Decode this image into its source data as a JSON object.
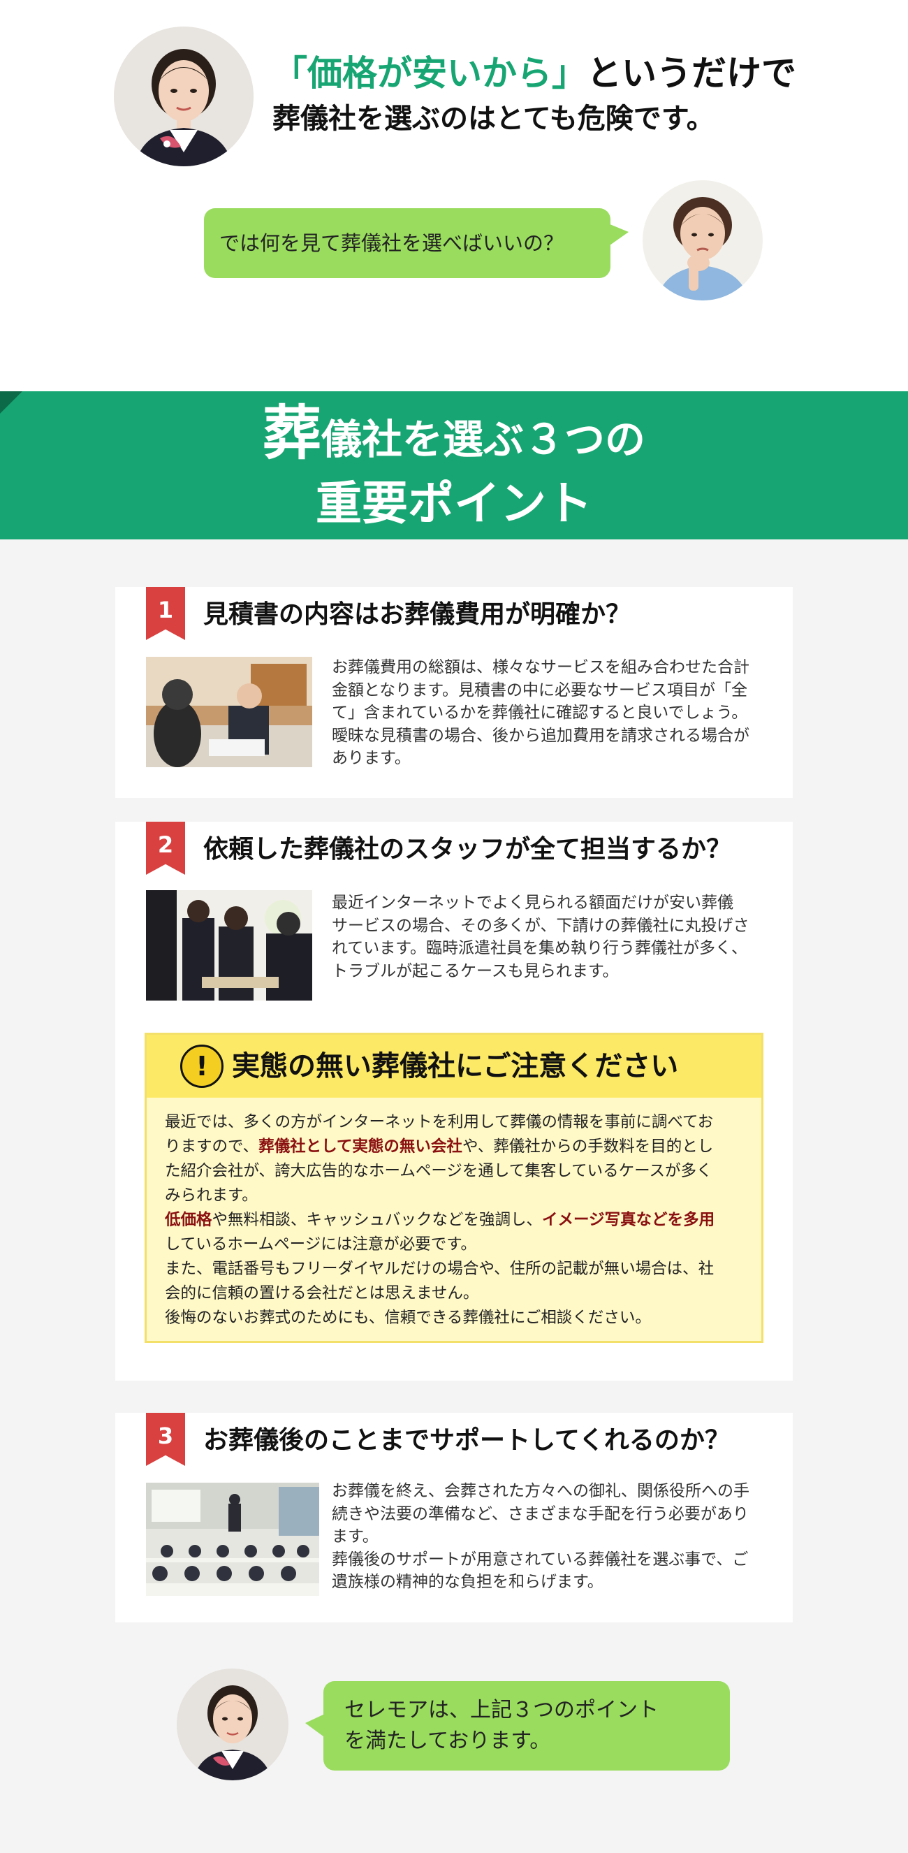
{
  "colors": {
    "brand_green": "#17a673",
    "bubble_green": "#99dc5e",
    "accent_red": "#d94140",
    "warning_yellow": "#fcea66",
    "highlight_dark_red": "#8a1010"
  },
  "intro": {
    "headline_highlight": "「価格が安いから」",
    "headline_rest": "というだけで",
    "headline_line2": "葬儀社を選ぶのはとても危険です。",
    "question": "では何を見て葬儀社を選べばいいの？"
  },
  "banner": {
    "title_first_char": "葬",
    "title_line1_rest": "儀社を選ぶ３つの",
    "title_line2": "重要ポイント"
  },
  "points": [
    {
      "number": "1",
      "title": "見積書の内容はお葬儀費用が明確か？",
      "text": [
        "お葬儀費用の総額は、様々なサービスを組み合わせた合計",
        "金額となります。見積書の中に必要なサービス項目が「全",
        "て」含まれているかを葬儀社に確認すると良いでしょう。",
        "曖昧な見積書の場合、後から追加費用を請求される場合が",
        "あります。"
      ]
    },
    {
      "number": "2",
      "title": "依頼した葬儀社のスタッフが全て担当するか？",
      "text": [
        "最近インターネットでよく見られる額面だけが安い葬儀",
        "サービスの場合、その多くが、下請けの葬儀社に丸投げさ",
        "れています。臨時派遣社員を集め執り行う葬儀社が多く、",
        "トラブルが起こるケースも見られます。"
      ]
    },
    {
      "number": "3",
      "title": "お葬儀後のことまでサポートしてくれるのか？",
      "text": [
        "お葬儀を終え、会葬された方々への御礼、関係役所への手",
        "続きや法要の準備など、さまざまな手配を行う必要があり",
        "ます。",
        "葬儀後のサポートが用意されている葬儀社を選ぶ事で、ご",
        "遺族様の精神的な負担を和らげます。"
      ]
    }
  ],
  "warning": {
    "icon": "!",
    "icon_name": "exclamation-icon",
    "title": "実態の無い葬儀社にご注意ください",
    "line1": "最近では、多くの方がインターネットを利用して葬儀の情報を事前に調べてお",
    "line2_a": "りますので、",
    "line2_b": "葬儀社として実態の無い会社",
    "line2_c": "や、葬儀社からの手数料を目的とし",
    "line3": "た紹介会社が、誇大広告的なホームページを通して集客しているケースが多く",
    "line4": "みられます。",
    "line5_a": "低価格",
    "line5_b": "や無料相談、キャッシュバックなどを強調し、",
    "line5_c": "イメージ写真などを多用",
    "line6": "しているホームページには注意が必要です。",
    "line7": "また、電話番号もフリーダイヤルだけの場合や、住所の記載が無い場合は、社",
    "line8": "会的に信頼の置ける会社だとは思えません。",
    "line9": "後悔のないお葬式のためにも、信頼できる葬儀社にご相談ください。"
  },
  "closing": {
    "line1": "セレモアは、上記３つのポイント",
    "line2": "を満たしております。"
  }
}
